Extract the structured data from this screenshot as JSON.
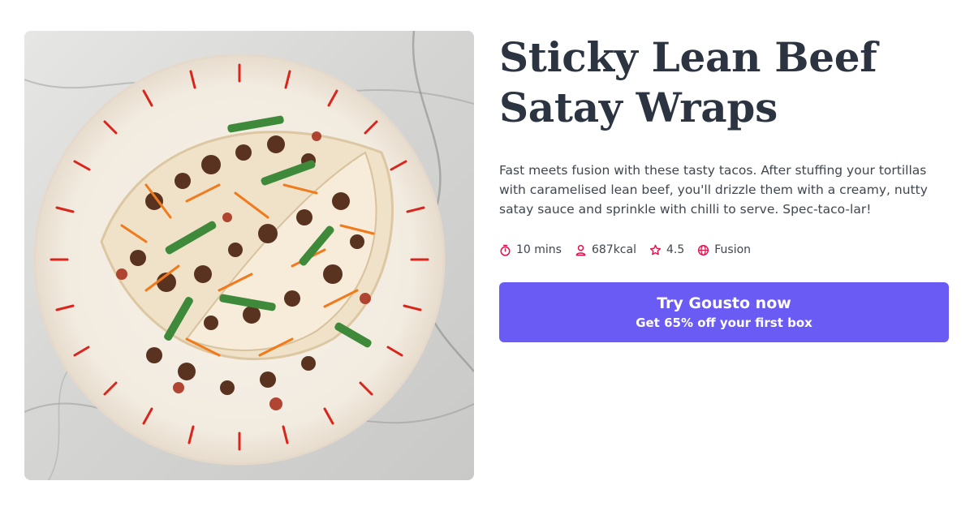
{
  "recipe": {
    "title": "Sticky Lean Beef Satay Wraps",
    "description": "Fast meets fusion with these tasty tacos. After stuffing your tortillas with caramelised lean beef, you'll drizzle them with a creamy, nutty satay sauce and sprinkle with chilli to serve. Spec-taco-lar!",
    "meta": {
      "time": "10 mins",
      "calories": "687kcal",
      "rating": "4.5",
      "cuisine": "Fusion"
    },
    "icons": {
      "time": "stopwatch-icon",
      "calories": "person-icon",
      "rating": "star-icon",
      "cuisine": "globe-icon"
    }
  },
  "cta": {
    "label": "Try Gousto now",
    "sublabel": "Get 65% off your first box"
  },
  "colors": {
    "accent": "#6b5bf5",
    "icon": "#e0104a",
    "title": "#2b3440",
    "text": "#3f4650"
  }
}
